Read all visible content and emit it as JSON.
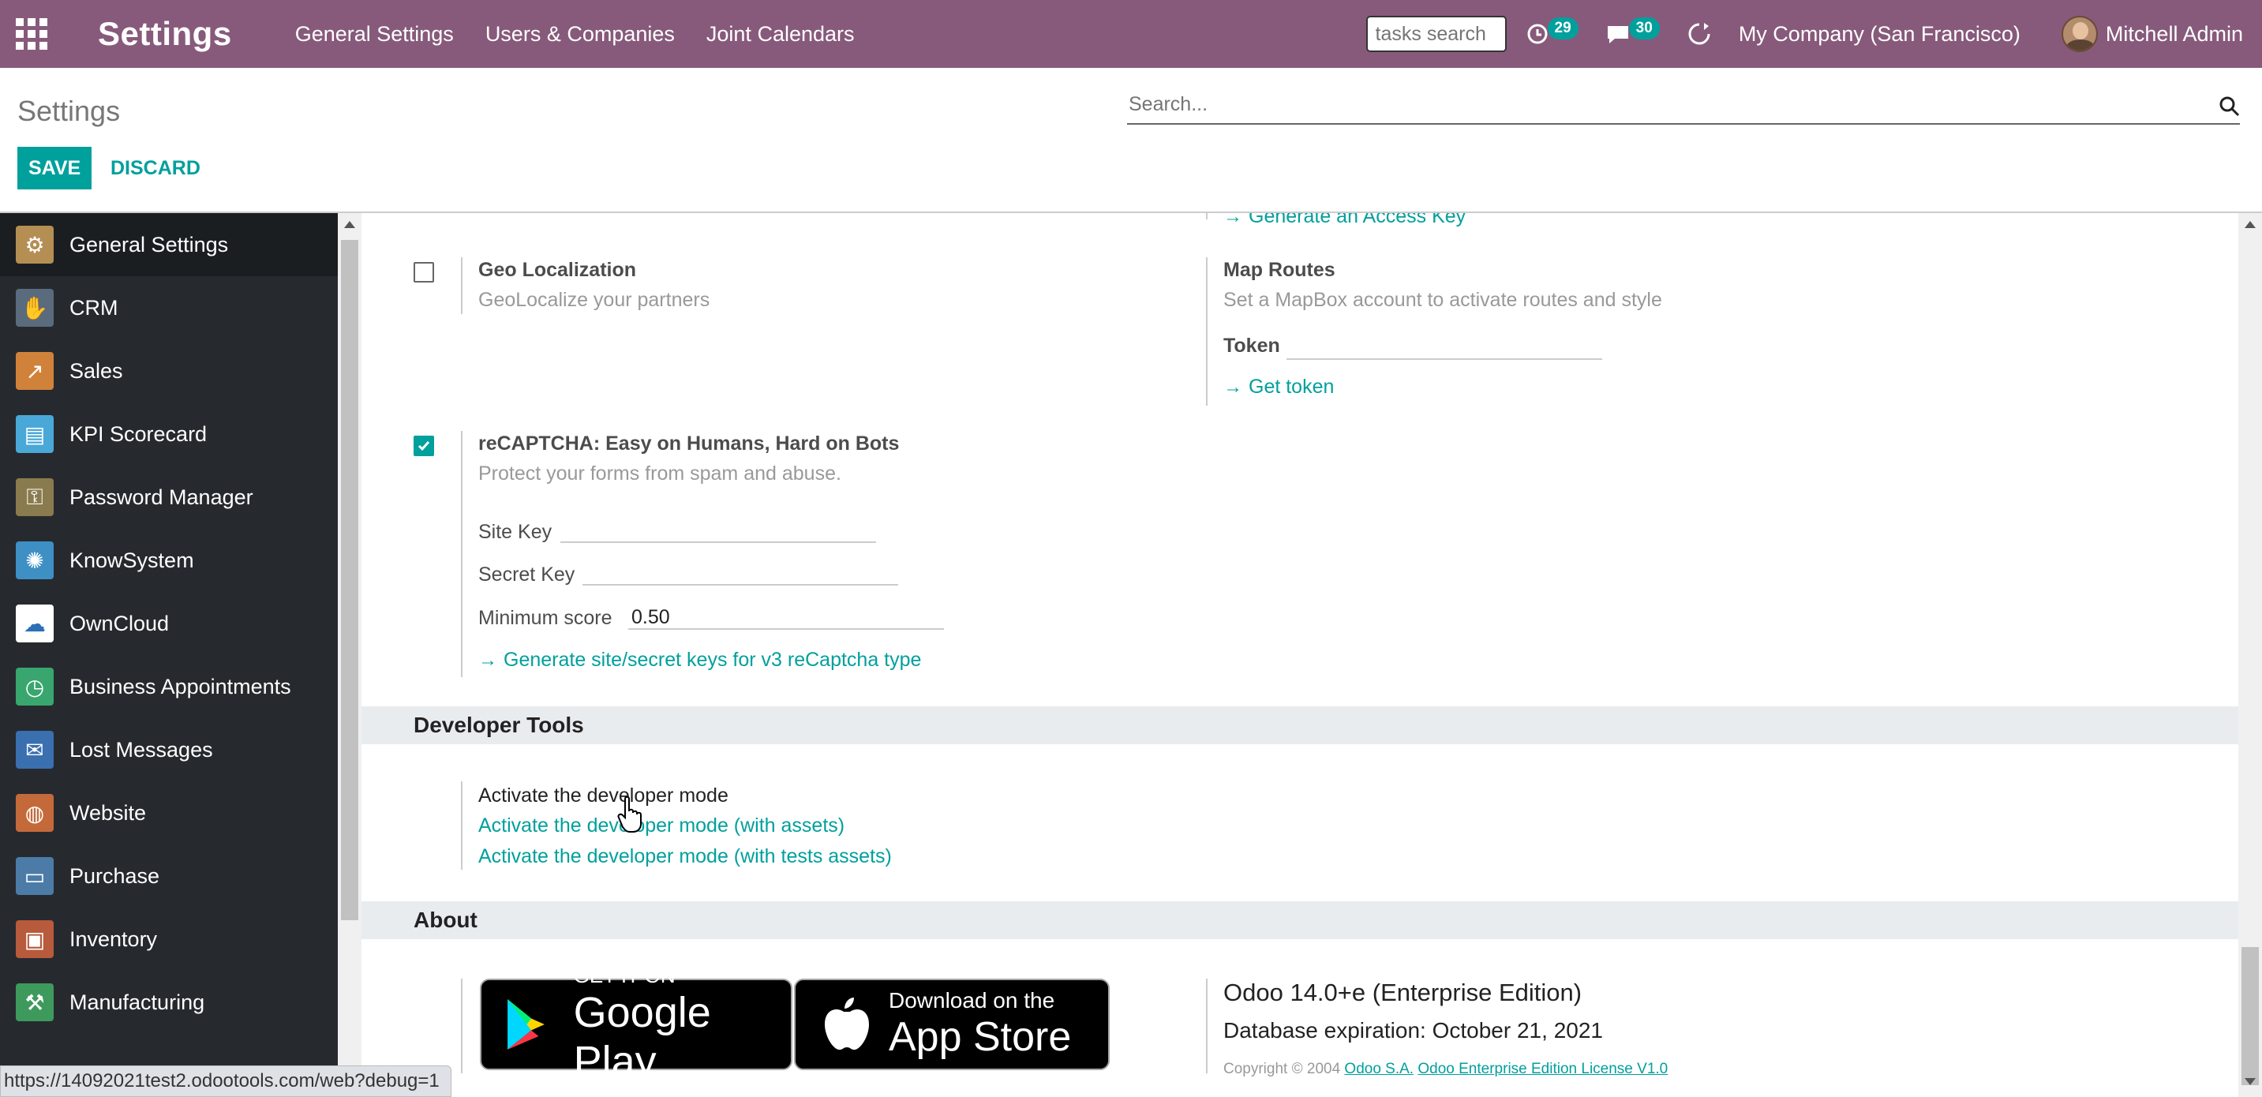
{
  "navbar": {
    "app_title": "Settings",
    "menu": [
      "General Settings",
      "Users & Companies",
      "Joint Calendars"
    ],
    "tasks_search_placeholder": "tasks search",
    "activity_count": "29",
    "messages_count": "30",
    "company": "My Company (San Francisco)",
    "user": "Mitchell Admin"
  },
  "control_panel": {
    "title": "Settings",
    "search_placeholder": "Search...",
    "save_label": "SAVE",
    "discard_label": "DISCARD"
  },
  "sidebar": {
    "items": [
      {
        "label": "General Settings",
        "icon": "gear-icon",
        "color": "#b58e53"
      },
      {
        "label": "CRM",
        "icon": "handshake-icon",
        "color": "#5a6b7d"
      },
      {
        "label": "Sales",
        "icon": "chart-line-icon",
        "color": "#d0823b"
      },
      {
        "label": "KPI Scorecard",
        "icon": "scorecard-icon",
        "color": "#4aa8d8"
      },
      {
        "label": "Password Manager",
        "icon": "key-icon",
        "color": "#8a7b4e"
      },
      {
        "label": "KnowSystem",
        "icon": "brain-icon",
        "color": "#3e8fc4"
      },
      {
        "label": "OwnCloud",
        "icon": "cloud-icon",
        "color": "#ffffff"
      },
      {
        "label": "Business Appointments",
        "icon": "clock-icon",
        "color": "#38a66e"
      },
      {
        "label": "Lost Messages",
        "icon": "envelope-question-icon",
        "color": "#3a6fb0"
      },
      {
        "label": "Website",
        "icon": "globe-icon",
        "color": "#c46a3a"
      },
      {
        "label": "Purchase",
        "icon": "credit-card-icon",
        "color": "#4c7ba8"
      },
      {
        "label": "Inventory",
        "icon": "box-icon",
        "color": "#b85a3c"
      },
      {
        "label": "Manufacturing",
        "icon": "wrench-icon",
        "color": "#3d9a5c"
      }
    ]
  },
  "settings": {
    "access_key_link": "Generate an Access Key",
    "geo": {
      "title": "Geo Localization",
      "desc": "GeoLocalize your partners",
      "checked": false
    },
    "map_routes": {
      "title": "Map Routes",
      "desc": "Set a MapBox account to activate routes and style",
      "token_label": "Token",
      "token_value": "",
      "get_token_link": "Get token"
    },
    "recaptcha": {
      "title": "reCAPTCHA: Easy on Humans, Hard on Bots",
      "desc": "Protect your forms from spam and abuse.",
      "checked": true,
      "site_key_label": "Site Key",
      "site_key_value": "",
      "secret_key_label": "Secret Key",
      "secret_key_value": "",
      "min_score_label": "Minimum score",
      "min_score_value": "0.50",
      "generate_link": "Generate site/secret keys for v3 reCaptcha type"
    }
  },
  "developer_tools": {
    "heading": "Developer Tools",
    "activate": "Activate the developer mode",
    "activate_assets": "Activate the developer mode (with assets)",
    "activate_tests": "Activate the developer mode (with tests assets)"
  },
  "about": {
    "heading": "About",
    "google_play_top": "GET IT ON",
    "google_play_bottom": "Google Play",
    "app_store_top": "Download on the",
    "app_store_bottom": "App Store",
    "version": "Odoo 14.0+e (Enterprise Edition)",
    "expiration": "Database expiration: October 21, 2021",
    "copyright_prefix": "Copyright © 2004",
    "odoo_sa_link": "Odoo S.A.",
    "license_link": "Odoo Enterprise Edition License V1.0"
  },
  "status_bar": {
    "url": "https://14092021test2.odootools.com/web?debug=1"
  }
}
